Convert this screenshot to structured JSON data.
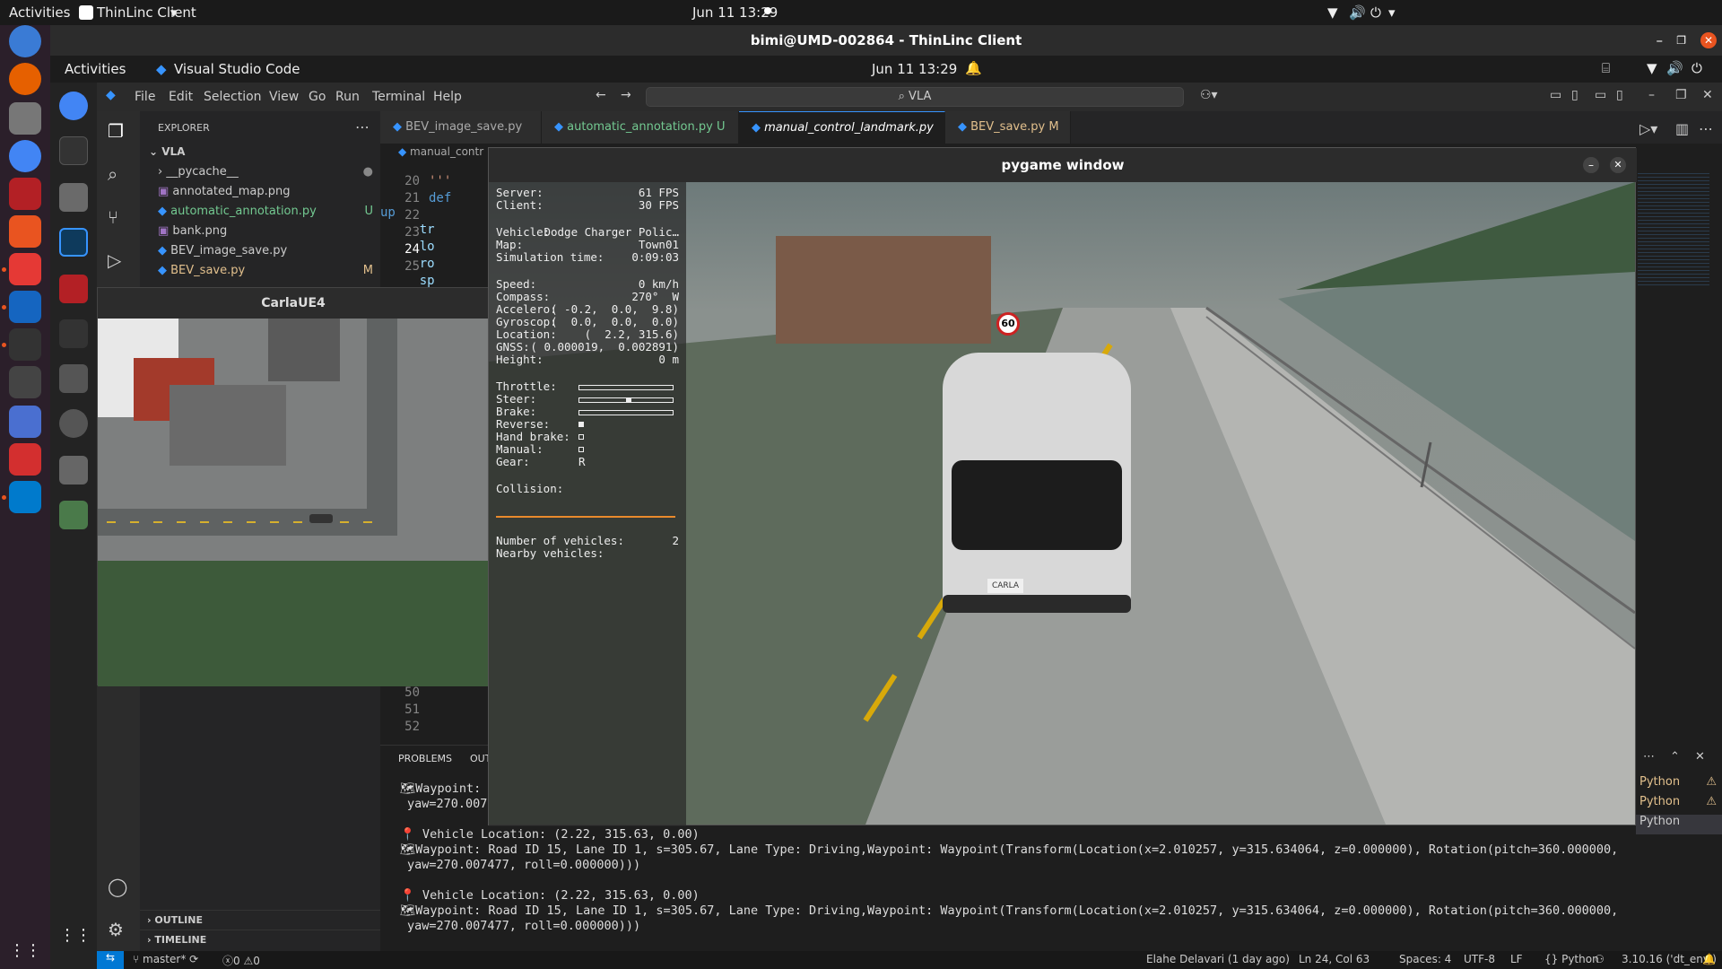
{
  "host": {
    "activities": "Activities",
    "app_menu": "ThinLinc Client",
    "clock": "Jun 11  13:29"
  },
  "thinlinc": {
    "title": "bimi@UMD-002864 - ThinLinc Client"
  },
  "remote": {
    "activities": "Activities",
    "app_name": "Visual Studio Code",
    "clock": "Jun 11  13:29"
  },
  "vscode": {
    "menu": [
      "File",
      "Edit",
      "Selection",
      "View",
      "Go",
      "Run",
      "Terminal",
      "Help"
    ],
    "search": "VLA",
    "explorer_title": "EXPLORER",
    "folder": "VLA",
    "files": [
      {
        "name": "__pycache__",
        "status": ""
      },
      {
        "name": "annotated_map.png",
        "status": ""
      },
      {
        "name": "automatic_annotation.py",
        "status": "U"
      },
      {
        "name": "bank.png",
        "status": ""
      },
      {
        "name": "BEV_image_save.py",
        "status": ""
      },
      {
        "name": "BEV_save.py",
        "status": "M"
      }
    ],
    "outline": "OUTLINE",
    "timeline": "TIMELINE",
    "tabs": [
      {
        "label": "BEV_image_save.py",
        "badge": ""
      },
      {
        "label": "automatic_annotation.py",
        "badge": "U"
      },
      {
        "label": "manual_control_landmark.py",
        "badge": ""
      },
      {
        "label": "BEV_save.py",
        "badge": "M"
      }
    ],
    "breadcrumb": "manual_contr",
    "editor_lines": [
      {
        "num": "20",
        "code": "'''"
      },
      {
        "num": "21",
        "code": "def up"
      },
      {
        "num": "22",
        "code": "    tr"
      },
      {
        "num": "23",
        "code": "    lo"
      },
      {
        "num": "24",
        "code": "    ro"
      },
      {
        "num": "25",
        "code": "    sp"
      }
    ],
    "lower_lines": [
      "50",
      "51",
      "52"
    ],
    "panel_tabs": [
      "PROBLEMS",
      "OUT"
    ],
    "terminal": [
      "Waypoint: R",
      "yaw=270.007",
      "📍 Vehicle Location: (2.22, 315.63, 0.00)",
      "Waypoint: Road ID 15, Lane ID 1, s=305.67, Lane Type: Driving,Waypoint: Waypoint(Transform(Location(x=2.010257, y=315.634064, z=0.000000), Rotation(pitch=360.000000,",
      "yaw=270.007477, roll=0.000000)))",
      "📍 Vehicle Location: (2.22, 315.63, 0.00)",
      "Waypoint: Road ID 15, Lane ID 1, s=305.67, Lane Type: Driving,Waypoint: Waypoint(Transform(Location(x=2.010257, y=315.634064, z=0.000000), Rotation(pitch=360.000000,",
      "yaw=270.007477, roll=0.000000)))"
    ],
    "right_panel_items": [
      "Python",
      "Python",
      "Python"
    ],
    "status": {
      "branch": "master*",
      "errors": "0",
      "warnings": "0",
      "blame": "Elahe Delavari (1 day ago)",
      "cursor": "Ln 24, Col 63",
      "spaces": "Spaces: 4",
      "encoding": "UTF-8",
      "eol": "LF",
      "language": "Python",
      "interpreter": "3.10.16 ('dt_env')"
    }
  },
  "carla_window": {
    "title": "CarlaUE4"
  },
  "pygame": {
    "title": "pygame window",
    "hud": {
      "server_label": "Server:",
      "server": "61 FPS",
      "client_label": "Client:",
      "client": "30 FPS",
      "vehicle_label": "Vehicle:",
      "vehicle": "Dodge Charger Polic…",
      "map_label": "Map:",
      "map": "Town01",
      "sim_label": "Simulation time:",
      "sim": "0:09:03",
      "speed_label": "Speed:",
      "speed": "0 km/h",
      "compass_label": "Compass:",
      "compass": "270°  W",
      "accel_label": "Accelero:",
      "accel": "( -0.2,  0.0,  9.8)",
      "gyro_label": "Gyroscop:",
      "gyro": "(  0.0,  0.0,  0.0)",
      "loc_label": "Location:",
      "loc": "(  2.2, 315.6)",
      "gnss_label": "GNSS:",
      "gnss": "( 0.000019,  0.002891)",
      "height_label": "Height:",
      "height": "0 m",
      "throttle_label": "Throttle:",
      "steer_label": "Steer:",
      "brake_label": "Brake:",
      "reverse_label": "Reverse:",
      "handbrake_label": "Hand brake:",
      "manual_label": "Manual:",
      "gear_label": "Gear:",
      "gear": "R",
      "collision_label": "Collision:",
      "nveh_label": "Number of vehicles:",
      "nveh": "2",
      "nearby_label": "Nearby vehicles:"
    },
    "throttle": 0.0,
    "steer": 0.0,
    "brake": 0.0,
    "sign": "60",
    "plate": "CARLA"
  },
  "colors": {
    "accent": "#3794ff",
    "ubuntu_orange": "#e95420",
    "untracked": "#73c991",
    "modified": "#e2c08d"
  }
}
